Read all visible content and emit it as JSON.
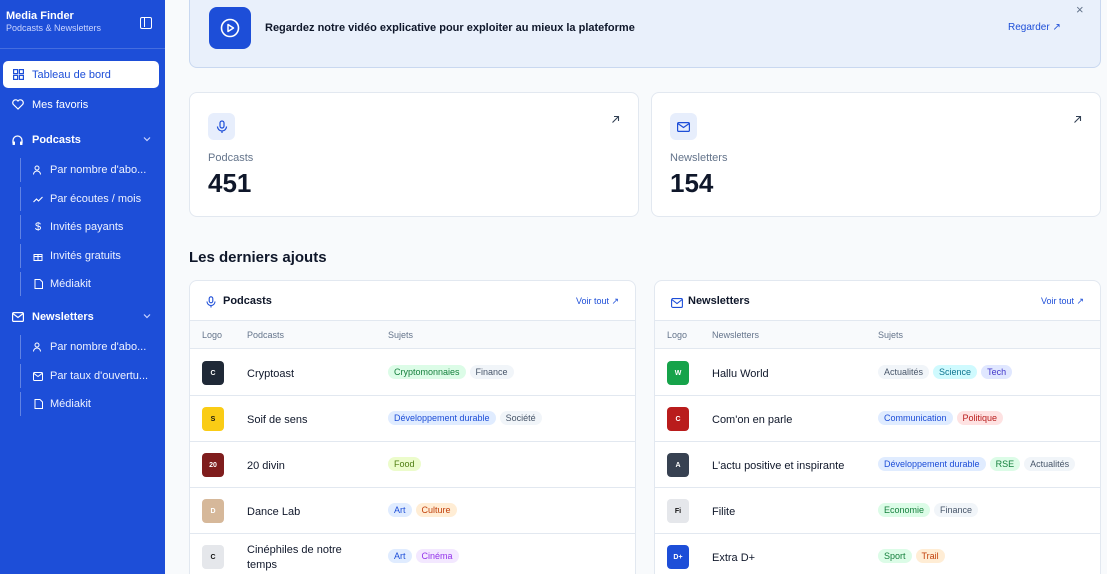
{
  "sidebar": {
    "title": "Media Finder",
    "subtitle": "Podcasts & Newsletters",
    "dashboard": "Tableau de bord",
    "favorites": "Mes favoris",
    "podcasts": {
      "label": "Podcasts",
      "items": [
        "Par nombre d'abo...",
        "Par écoutes / mois",
        "Invités payants",
        "Invités gratuits",
        "Médiakit"
      ]
    },
    "newsletters": {
      "label": "Newsletters",
      "items": [
        "Par nombre d'abo...",
        "Par taux d'ouvertu...",
        "Médiakit"
      ]
    }
  },
  "banner": {
    "text": "Regardez notre vidéo explicative pour exploiter au mieux la plateforme",
    "link": "Regarder ↗",
    "close": "×"
  },
  "stats": {
    "podcasts": {
      "label": "Podcasts",
      "value": "451"
    },
    "newsletters": {
      "label": "Newsletters",
      "value": "154"
    }
  },
  "latest_title": "Les derniers ajouts",
  "podcasts_table": {
    "title": "Podcasts",
    "link": "Voir tout ↗",
    "columns": [
      "Logo",
      "Podcasts",
      "Sujets"
    ],
    "rows": [
      {
        "name": "Cryptoast",
        "logo": "C",
        "tags": [
          {
            "t": "Cryptomonnaies",
            "c": "green"
          },
          {
            "t": "Finance",
            "c": "gray"
          }
        ]
      },
      {
        "name": "Soif de sens",
        "logo": "S",
        "tags": [
          {
            "t": "Développement durable",
            "c": "blue"
          },
          {
            "t": "Société",
            "c": "gray"
          }
        ]
      },
      {
        "name": "20 divin",
        "logo": "20",
        "tags": [
          {
            "t": "Food",
            "c": "lime"
          }
        ]
      },
      {
        "name": "Dance Lab",
        "logo": "D",
        "tags": [
          {
            "t": "Art",
            "c": "blue"
          },
          {
            "t": "Culture",
            "c": "orange"
          }
        ]
      },
      {
        "name": "Cinéphiles de notre temps",
        "logo": "C",
        "tags": [
          {
            "t": "Art",
            "c": "blue"
          },
          {
            "t": "Cinéma",
            "c": "purple"
          }
        ]
      }
    ]
  },
  "newsletters_table": {
    "title": "Newsletters",
    "link": "Voir tout ↗",
    "columns": [
      "Logo",
      "Newsletters",
      "Sujets"
    ],
    "rows": [
      {
        "name": "Hallu World",
        "logo": "W",
        "tags": [
          {
            "t": "Actualités",
            "c": "gray"
          },
          {
            "t": "Science",
            "c": "cyan"
          },
          {
            "t": "Tech",
            "c": "indigo"
          }
        ]
      },
      {
        "name": "Com'on en parle",
        "logo": "C",
        "tags": [
          {
            "t": "Communication",
            "c": "blue"
          },
          {
            "t": "Politique",
            "c": "red"
          }
        ]
      },
      {
        "name": "L'actu positive et inspirante",
        "logo": "A",
        "tags": [
          {
            "t": "Développement durable",
            "c": "blue"
          },
          {
            "t": "RSE",
            "c": "green"
          },
          {
            "t": "Actualités",
            "c": "gray"
          }
        ]
      },
      {
        "name": "Filite",
        "logo": "Fi",
        "tags": [
          {
            "t": "Economie",
            "c": "green"
          },
          {
            "t": "Finance",
            "c": "gray"
          }
        ]
      },
      {
        "name": "Extra D+",
        "logo": "D+",
        "tags": [
          {
            "t": "Sport",
            "c": "green"
          },
          {
            "t": "Trail",
            "c": "orange"
          }
        ]
      }
    ]
  },
  "colors": {
    "primary": "#1d4ed8",
    "tag_green": "#dcfce7",
    "tag_gray": "#f1f5f9",
    "tag_blue": "#e0ecff",
    "tag_lime": "#ecfccb",
    "tag_orange": "#ffedd5",
    "tag_purple": "#f3e8ff",
    "tag_cyan": "#cffafe",
    "tag_indigo": "#e0e7ff",
    "tag_red": "#fee2e2"
  }
}
